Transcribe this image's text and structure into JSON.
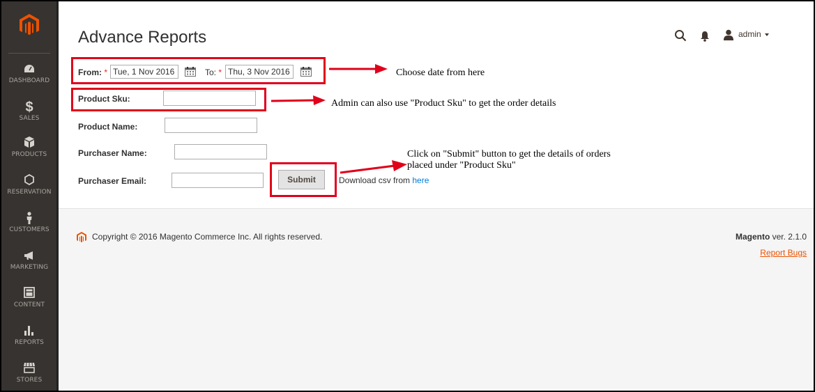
{
  "sidebar": {
    "items": [
      {
        "label": "DASHBOARD",
        "icon": "dashboard-icon"
      },
      {
        "label": "SALES",
        "icon": "dollar-icon"
      },
      {
        "label": "PRODUCTS",
        "icon": "box-icon"
      },
      {
        "label": "RESERVATION",
        "icon": "hexagon-icon"
      },
      {
        "label": "CUSTOMERS",
        "icon": "person-icon"
      },
      {
        "label": "MARKETING",
        "icon": "megaphone-icon"
      },
      {
        "label": "CONTENT",
        "icon": "layout-icon"
      },
      {
        "label": "REPORTS",
        "icon": "bar-chart-icon"
      },
      {
        "label": "STORES",
        "icon": "store-icon"
      }
    ]
  },
  "header": {
    "title": "Advance Reports",
    "user": "admin"
  },
  "form": {
    "from_label": "From:",
    "from_value": "Tue, 1 Nov 2016",
    "to_label": "To:",
    "to_value": "Thu, 3 Nov 2016",
    "required_mark": "*",
    "sku_label": "Product Sku:",
    "sku_value": "",
    "name_label": "Product Name:",
    "name_value": "",
    "purchaser_name_label": "Purchaser Name:",
    "purchaser_name_value": "",
    "purchaser_email_label": "Purchaser Email:",
    "purchaser_email_value": "",
    "submit_label": "Submit",
    "download_text": "Download csv from ",
    "download_link": "here"
  },
  "annotations": {
    "date_note": "Choose date from here",
    "sku_note": "Admin can also use \"Product Sku\" to get the order details",
    "submit_note_line1": "Click on \"Submit\" button to get the details of orders",
    "submit_note_line2": "placed under \"Product Sku\"",
    "color": "#e0001b"
  },
  "footer": {
    "copyright": "Copyright © 2016 Magento Commerce Inc. All rights reserved.",
    "brand": "Magento",
    "version": " ver. 2.1.0",
    "report_bugs": "Report Bugs"
  },
  "colors": {
    "sidebar_bg": "#373330",
    "logo": "#eb5202",
    "link": "#007bdb",
    "report_bugs": "#eb5202"
  }
}
